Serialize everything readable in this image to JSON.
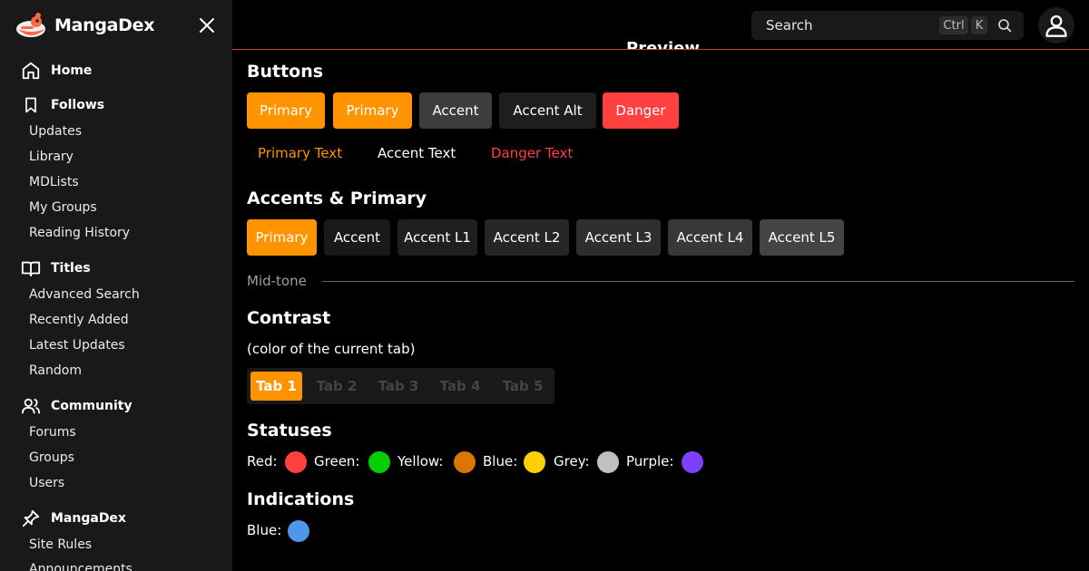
{
  "brand": {
    "name": "MangaDex"
  },
  "sidebar": {
    "sections": [
      {
        "label": "Home",
        "icon": "home-icon",
        "items": []
      },
      {
        "label": "Follows",
        "icon": "bookmark-icon",
        "items": [
          "Updates",
          "Library",
          "MDLists",
          "My Groups",
          "Reading History"
        ]
      },
      {
        "label": "Titles",
        "icon": "book-open-icon",
        "items": [
          "Advanced Search",
          "Recently Added",
          "Latest Updates",
          "Random"
        ]
      },
      {
        "label": "Community",
        "icon": "users-icon",
        "items": [
          "Forums",
          "Groups",
          "Users"
        ]
      },
      {
        "label": "MangaDex",
        "icon": "pin-icon",
        "items": [
          "Site Rules",
          "Announcements"
        ]
      }
    ]
  },
  "search": {
    "placeholder": "Search",
    "kbd_ctrl": "Ctrl",
    "kbd_k": "K"
  },
  "main": {
    "preview_heading": "Preview",
    "buttons": {
      "title": "Buttons",
      "row": [
        "Primary",
        "Primary",
        "Accent",
        "Accent Alt",
        "Danger"
      ],
      "text_row": [
        "Primary Text",
        "Accent Text",
        "Danger Text"
      ]
    },
    "accents": {
      "title": "Accents & Primary",
      "row": [
        "Primary",
        "Accent",
        "Accent L1",
        "Accent L2",
        "Accent L3",
        "Accent L4",
        "Accent L5"
      ]
    },
    "midtone": "Mid-tone",
    "contrast": {
      "title": "Contrast",
      "subtitle": "(color of the current tab)",
      "tabs": [
        "Tab 1",
        "Tab 2",
        "Tab 3",
        "Tab 4",
        "Tab 5"
      ],
      "active_tab": 0
    },
    "statuses": {
      "title": "Statuses",
      "items": [
        {
          "label": "Red:",
          "color": "#ff4040"
        },
        {
          "label": "Green:",
          "color": "#04d000"
        },
        {
          "label": "Yellow:",
          "color": "#da7500"
        },
        {
          "label": "Blue:",
          "color": "#ffd000"
        },
        {
          "label": "Grey:",
          "color": "#c0c0c0"
        },
        {
          "label": "Purple:",
          "color": "#7d40ff"
        }
      ]
    },
    "indications": {
      "title": "Indications",
      "items": [
        {
          "label": "Blue:",
          "color": "#4f97e8"
        }
      ]
    }
  },
  "colors": {
    "primary": "#ff9400",
    "accent": "#2c2c2c",
    "accent_alt": "#191919",
    "danger": "#ff4040",
    "sidebar_bg": "#191919",
    "topbar_line": "#ff6740"
  }
}
